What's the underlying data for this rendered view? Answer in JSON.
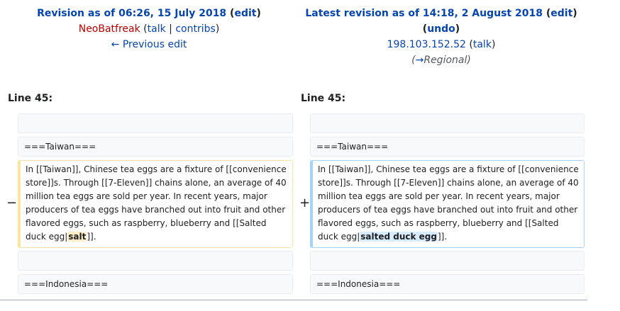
{
  "left_header": {
    "title_prefix": "Revision as of 06:26, 15 July 2018",
    "edit_link": "edit",
    "user": "NeoBatfreak",
    "talk_link": "talk",
    "contribs_link": "contribs",
    "previous_edit": "← Previous edit"
  },
  "right_header": {
    "title_prefix": "Latest revision as of 14:18, 2 August 2018",
    "edit_link": "edit",
    "undo_link": "undo",
    "user": "198.103.152.52",
    "talk_link": "talk",
    "summary_arrow": "→",
    "summary_section": "Regional"
  },
  "line_number_left": "Line 45:",
  "line_number_right": "Line 45:",
  "context": {
    "heading_taiwan": "===Taiwan===",
    "heading_indonesia": "===Indonesia==="
  },
  "changed": {
    "before_text": "In [[Taiwan]], Chinese tea eggs are a fixture of [[convenience store]]s. Through [[7-Eleven]] chains alone, an average of 40 million tea eggs are sold per year. In recent years, major producers of tea eggs have branched out into fruit and other flavored eggs, such as raspberry, blueberry and [[Salted duck egg|",
    "deleted_word": "salt",
    "added_word": "salted duck egg",
    "after_text": "]].",
    "minus": "−",
    "plus": "+"
  }
}
